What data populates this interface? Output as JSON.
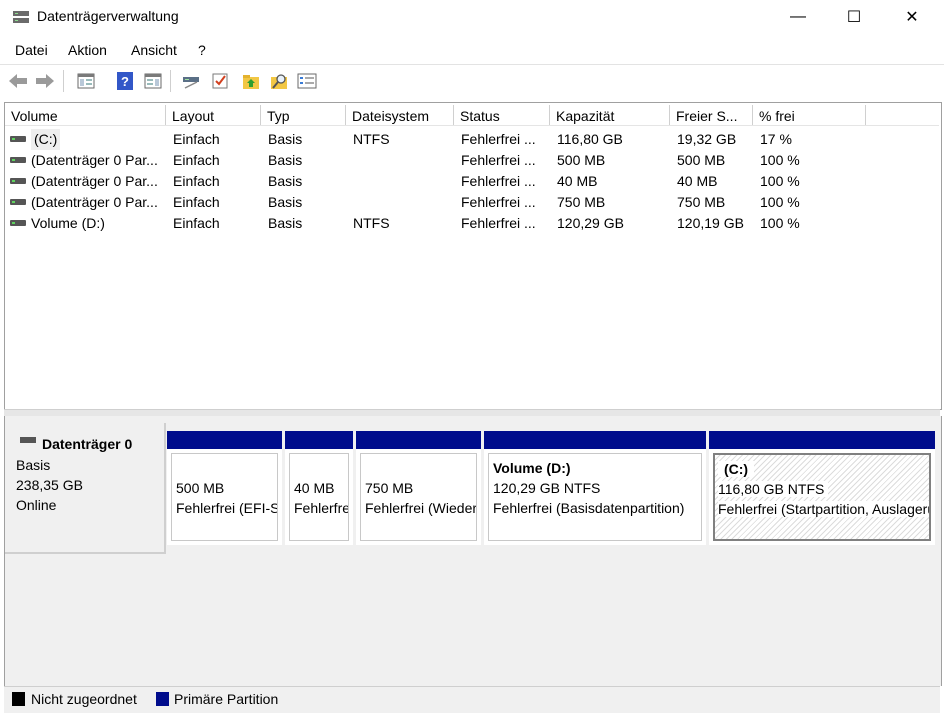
{
  "window": {
    "title": "Datenträgerverwaltung",
    "minimize": "—",
    "maximize": "☐",
    "close": "✕"
  },
  "menu": [
    "Datei",
    "Aktion",
    "Ansicht",
    "?"
  ],
  "toolbar": {
    "icons": [
      "back-arrow-icon",
      "forward-arrow-icon",
      "console-tree-icon",
      "help-icon",
      "action-pane-icon",
      "connect-icon",
      "check-icon",
      "up-folder-icon",
      "search-icon",
      "properties-icon"
    ]
  },
  "list": {
    "columns": [
      "Volume",
      "Layout",
      "Typ",
      "Dateisystem",
      "Status",
      "Kapazität",
      "Freier S...",
      "% frei"
    ],
    "rows": [
      [
        "(C:)",
        "Einfach",
        "Basis",
        "NTFS",
        "Fehlerfrei ...",
        "116,80 GB",
        "19,32 GB",
        "17 %"
      ],
      [
        "(Datenträger 0 Par...",
        "Einfach",
        "Basis",
        "",
        "Fehlerfrei ...",
        "500 MB",
        "500 MB",
        "100 %"
      ],
      [
        "(Datenträger 0 Par...",
        "Einfach",
        "Basis",
        "",
        "Fehlerfrei ...",
        "40 MB",
        "40 MB",
        "100 %"
      ],
      [
        "(Datenträger 0 Par...",
        "Einfach",
        "Basis",
        "",
        "Fehlerfrei ...",
        "750 MB",
        "750 MB",
        "100 %"
      ],
      [
        "Volume (D:)",
        "Einfach",
        "Basis",
        "NTFS",
        "Fehlerfrei ...",
        "120,29 GB",
        "120,19 GB",
        "100 %"
      ]
    ]
  },
  "disk": {
    "name": "Datenträger 0",
    "type": "Basis",
    "size": "238,35 GB",
    "state": "Online"
  },
  "partitions": [
    {
      "title": "",
      "size": "500 MB",
      "status": "Fehlerfrei (EFI-Systempartition)"
    },
    {
      "title": "",
      "size": "40 MB",
      "status": "Fehlerfrei (OEM-Partition)"
    },
    {
      "title": "",
      "size": "750 MB",
      "status": "Fehlerfrei (Wiederherstellungspartition)"
    },
    {
      "title": "Volume  (D:)",
      "size": "120,29 GB NTFS",
      "status": "Fehlerfrei (Basisdatenpartition)"
    },
    {
      "title": "(C:)",
      "size": "116,80 GB NTFS",
      "status": "Fehlerfrei (Startpartition, Auslagerungsdatei)"
    }
  ],
  "legend": {
    "unallocated": "Nicht zugeordnet",
    "primary": "Primäre Partition",
    "unallocated_color": "#000000",
    "primary_color": "#000c8c"
  }
}
